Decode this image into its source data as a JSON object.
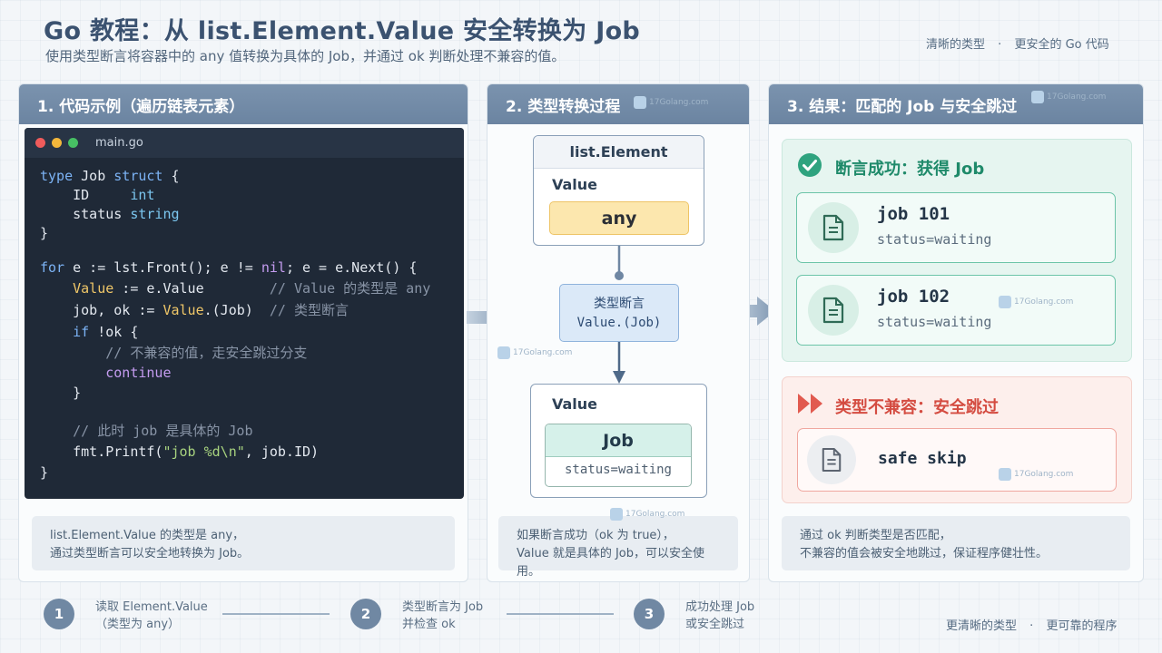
{
  "header": {
    "title": "Go 教程：从 list.Element.Value 安全转换为 Job",
    "subtitle": "使用类型断言将容器中的 any 值转换为具体的 Job，并通过 ok 判断处理不兼容的值。",
    "tagline_left": "清晰的类型",
    "tagline_sep": "·",
    "tagline_right": "更安全的 Go 代码"
  },
  "panel1": {
    "title": "1. 代码示例（遍历链表元素）",
    "filename": "main.go",
    "note_line1": "list.Element.Value 的类型是 any，",
    "note_line2": "通过类型断言可以安全地转换为 Job。"
  },
  "panel2": {
    "title": "2. 类型转换过程",
    "element_label": "list.Element",
    "value_label": "Value",
    "any_label": "any",
    "assert_line1": "类型断言",
    "assert_line2": "Value.(Job)",
    "result_value_label": "Value",
    "job_label": "Job",
    "job_status": "status=waiting",
    "note_line1": "如果断言成功（ok 为 true），",
    "note_line2": "Value 就是具体的 Job，可以安全使用。"
  },
  "panel3": {
    "title": "3. 结果：匹配的 Job 与安全跳过",
    "success_title": "断言成功：获得 Job",
    "jobs": [
      {
        "name": "job 101",
        "status": "status=waiting"
      },
      {
        "name": "job 102",
        "status": "status=waiting"
      }
    ],
    "fail_title": "类型不兼容：安全跳过",
    "skip_label": "safe skip",
    "note_line1": "通过 ok 判断类型是否匹配，",
    "note_line2": "不兼容的值会被安全地跳过，保证程序健壮性。"
  },
  "steps": [
    {
      "num": "1",
      "line1": "读取 Element.Value",
      "line2": "（类型为 any）"
    },
    {
      "num": "2",
      "line1": "类型断言为 Job",
      "line2": "并检查 ok"
    },
    {
      "num": "3",
      "line1": "成功处理 Job",
      "line2": "或安全跳过"
    }
  ],
  "footer": {
    "left": "更清晰的类型",
    "sep": "·",
    "right": "更可靠的程序"
  },
  "watermark": "17Golang.com",
  "colors": {
    "header": "#6b84a1",
    "success": "#2fa37f",
    "danger": "#e15a4f",
    "any": "#fce7ae",
    "job": "#d6f1ea"
  }
}
